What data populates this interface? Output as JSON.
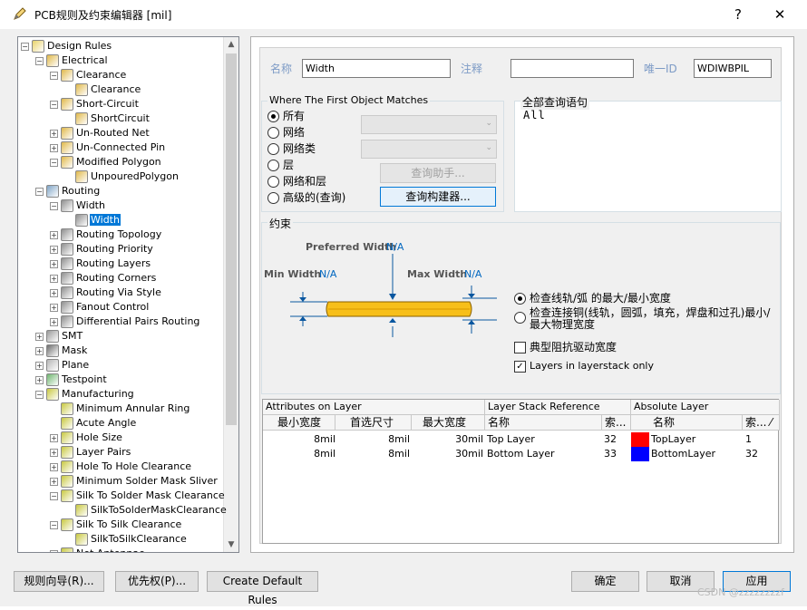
{
  "window": {
    "title": "PCB规则及约束编辑器 [mil]",
    "help_glyph": "?",
    "close_glyph": "✕"
  },
  "tree": {
    "expanders": {
      "plus": "+",
      "minus": "−"
    },
    "scroll_up": "▲",
    "scroll_down": "▼",
    "items": [
      {
        "label": "Design Rules",
        "level": 0,
        "exp": "minus",
        "icon": "design-rules-folder-icon"
      },
      {
        "label": "Electrical",
        "level": 1,
        "exp": "minus",
        "icon": "rule-category-icon"
      },
      {
        "label": "Clearance",
        "level": 2,
        "exp": "minus",
        "icon": "rule-icon"
      },
      {
        "label": "Clearance",
        "level": 3,
        "exp": "",
        "icon": "rule-icon"
      },
      {
        "label": "Short-Circuit",
        "level": 2,
        "exp": "minus",
        "icon": "rule-icon"
      },
      {
        "label": "ShortCircuit",
        "level": 3,
        "exp": "",
        "icon": "rule-icon"
      },
      {
        "label": "Un-Routed Net",
        "level": 2,
        "exp": "plus",
        "icon": "rule-icon"
      },
      {
        "label": "Un-Connected Pin",
        "level": 2,
        "exp": "plus",
        "icon": "rule-icon"
      },
      {
        "label": "Modified Polygon",
        "level": 2,
        "exp": "minus",
        "icon": "rule-icon"
      },
      {
        "label": "UnpouredPolygon",
        "level": 3,
        "exp": "",
        "icon": "rule-icon"
      },
      {
        "label": "Routing",
        "level": 1,
        "exp": "minus",
        "icon": "routing-category-icon"
      },
      {
        "label": "Width",
        "level": 2,
        "exp": "minus",
        "icon": "routing-rule-icon"
      },
      {
        "label": "Width",
        "level": 3,
        "exp": "",
        "icon": "routing-rule-icon",
        "selected": true
      },
      {
        "label": "Routing Topology",
        "level": 2,
        "exp": "plus",
        "icon": "routing-rule-icon"
      },
      {
        "label": "Routing Priority",
        "level": 2,
        "exp": "plus",
        "icon": "routing-rule-icon"
      },
      {
        "label": "Routing Layers",
        "level": 2,
        "exp": "plus",
        "icon": "routing-rule-icon"
      },
      {
        "label": "Routing Corners",
        "level": 2,
        "exp": "plus",
        "icon": "routing-rule-icon"
      },
      {
        "label": "Routing Via Style",
        "level": 2,
        "exp": "plus",
        "icon": "routing-rule-icon"
      },
      {
        "label": "Fanout Control",
        "level": 2,
        "exp": "plus",
        "icon": "routing-rule-icon"
      },
      {
        "label": "Differential Pairs Routing",
        "level": 2,
        "exp": "plus",
        "icon": "routing-rule-icon"
      },
      {
        "label": "SMT",
        "level": 1,
        "exp": "plus",
        "icon": "smt-category-icon"
      },
      {
        "label": "Mask",
        "level": 1,
        "exp": "plus",
        "icon": "mask-category-icon"
      },
      {
        "label": "Plane",
        "level": 1,
        "exp": "plus",
        "icon": "plane-category-icon"
      },
      {
        "label": "Testpoint",
        "level": 1,
        "exp": "plus",
        "icon": "testpoint-category-icon"
      },
      {
        "label": "Manufacturing",
        "level": 1,
        "exp": "minus",
        "icon": "manufacturing-category-icon"
      },
      {
        "label": "Minimum Annular Ring",
        "level": 2,
        "exp": "",
        "icon": "manufacturing-rule-icon"
      },
      {
        "label": "Acute Angle",
        "level": 2,
        "exp": "",
        "icon": "manufacturing-rule-icon"
      },
      {
        "label": "Hole Size",
        "level": 2,
        "exp": "plus",
        "icon": "manufacturing-rule-icon"
      },
      {
        "label": "Layer Pairs",
        "level": 2,
        "exp": "plus",
        "icon": "manufacturing-rule-icon"
      },
      {
        "label": "Hole To Hole Clearance",
        "level": 2,
        "exp": "plus",
        "icon": "manufacturing-rule-icon"
      },
      {
        "label": "Minimum Solder Mask Sliver",
        "level": 2,
        "exp": "plus",
        "icon": "manufacturing-rule-icon"
      },
      {
        "label": "Silk To Solder Mask Clearance",
        "level": 2,
        "exp": "minus",
        "icon": "manufacturing-rule-icon"
      },
      {
        "label": "SilkToSolderMaskClearance",
        "level": 3,
        "exp": "",
        "icon": "manufacturing-rule-icon"
      },
      {
        "label": "Silk To Silk Clearance",
        "level": 2,
        "exp": "minus",
        "icon": "manufacturing-rule-icon"
      },
      {
        "label": "SilkToSilkClearance",
        "level": 3,
        "exp": "",
        "icon": "manufacturing-rule-icon"
      },
      {
        "label": "Net Antennae",
        "level": 2,
        "exp": "plus",
        "icon": "manufacturing-rule-icon"
      }
    ]
  },
  "header": {
    "name_label": "名称",
    "name_value": "Width",
    "comment_label": "注释",
    "comment_value": "",
    "uid_label": "唯一ID",
    "uid_value": "WDIWBPIL"
  },
  "match": {
    "title": "Where The First Object Matches",
    "options": [
      "所有",
      "网络",
      "网络类",
      "层",
      "网络和层",
      "高级的(查询)"
    ],
    "selected_index": 0,
    "query_helper": "查询助手...",
    "query_builder": "查询构建器...",
    "combo_arrow": "⌄"
  },
  "query": {
    "title": "全部查询语句",
    "text": "All"
  },
  "constraints": {
    "title": "约束",
    "preferred_label": "Preferred Width",
    "preferred_value": "N/A",
    "min_label": "Min Width",
    "min_value": "N/A",
    "max_label": "Max Width",
    "max_value": "N/A",
    "radio1": "检查线轨/弧 的最大/最小宽度",
    "radio2": "检查连接铜(线轨，圆弧，填充，焊盘和过孔)最小/最大物理宽度",
    "check1": "典型阻抗驱动宽度",
    "check1_value": false,
    "check2": "Layers in layerstack only",
    "check2_value": true,
    "check_mark": "✓"
  },
  "grid": {
    "group_headers": [
      "Attributes on Layer",
      "Layer Stack Reference",
      "Absolute Layer"
    ],
    "col_headers": [
      "最小宽度",
      "首选尺寸",
      "最大宽度",
      "名称",
      "索...",
      "名称",
      "索..."
    ],
    "sort_glyph": "⁄",
    "rows": [
      {
        "min": "8mil",
        "pref": "8mil",
        "max": "30mil",
        "name": "Top Layer",
        "idx": "32",
        "abs_name": "TopLayer",
        "abs_idx": "1",
        "color": "#ff0000"
      },
      {
        "min": "8mil",
        "pref": "8mil",
        "max": "30mil",
        "name": "Bottom Layer",
        "idx": "33",
        "abs_name": "BottomLayer",
        "abs_idx": "32",
        "color": "#0000ff"
      }
    ]
  },
  "footer": {
    "wizard": "规则向导(R)...",
    "priority": "优先权(P)...",
    "create_default": "Create Default Rules",
    "ok": "确定",
    "cancel": "取消",
    "apply": "应用"
  },
  "watermark": "CSDN @zzzzzzzzf"
}
